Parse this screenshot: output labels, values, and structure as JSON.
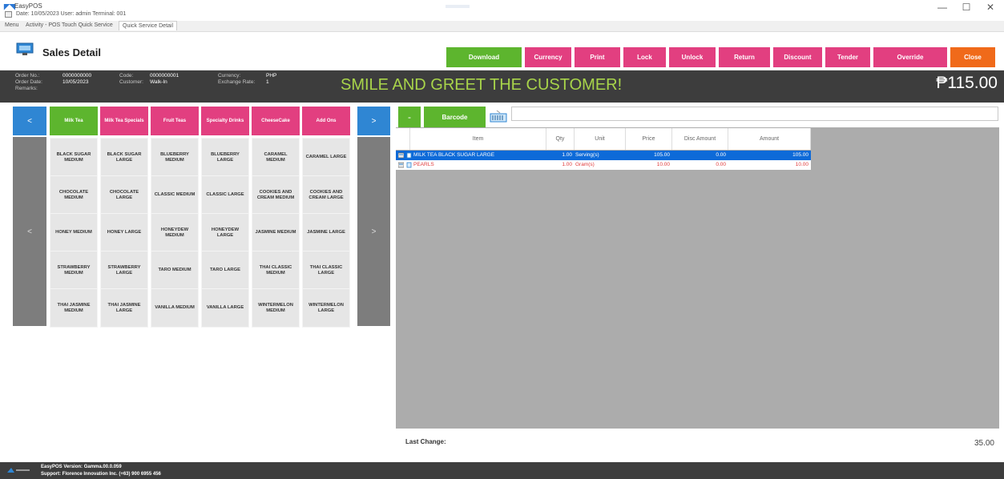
{
  "window": {
    "app_name": "EasyPOS",
    "info_line": "Date: 10/05/2023   User: admin   Terminal: 001",
    "minimize": "—",
    "maximize": "☐",
    "close": "✕"
  },
  "tabs": [
    {
      "label": "Menu"
    },
    {
      "label": "Activity - POS Touch Quick Service"
    },
    {
      "label": "Quick Service Detail"
    }
  ],
  "header": {
    "title": "Sales Detail",
    "buttons": [
      {
        "label": "Download",
        "color": "#5db52e"
      },
      {
        "label": "Currency",
        "color": "#e23f80"
      },
      {
        "label": "Print",
        "color": "#e23f80"
      },
      {
        "label": "Lock",
        "color": "#e23f80"
      },
      {
        "label": "Unlock",
        "color": "#e23f80"
      },
      {
        "label": "Return",
        "color": "#e23f80"
      },
      {
        "label": "Discount",
        "color": "#e23f80"
      },
      {
        "label": "Tender",
        "color": "#e23f80"
      },
      {
        "label": "Override",
        "color": "#e23f80"
      },
      {
        "label": "Close",
        "color": "#f06a1a"
      }
    ]
  },
  "info": {
    "order_no_label": "Order No.:",
    "order_no": "0000000000",
    "order_date_label": "Order Date:",
    "order_date": "10/05/2023",
    "remarks_label": "Remarks:",
    "code_label": "Code:",
    "code": "0000000001",
    "customer_label": "Customer:",
    "customer": "Walk-In",
    "currency_label": "Currency:",
    "currency": "PHP",
    "exchange_rate_label": "Exchange Rate:",
    "exchange_rate": "1",
    "greeting": "SMILE AND GREET THE CUSTOMER!",
    "total": "₱115.00"
  },
  "categories": {
    "prev": "<",
    "next": ">",
    "items": [
      {
        "label": "Milk Tea"
      },
      {
        "label": "Milk Tea Specials"
      },
      {
        "label": "Fruit Teas"
      },
      {
        "label": "Specialty Drinks"
      },
      {
        "label": "CheeseCake"
      },
      {
        "label": "Add Ons"
      }
    ]
  },
  "products": {
    "prev": "<",
    "next": ">",
    "items": [
      "BLACK SUGAR MEDIUM",
      "BLACK SUGAR LARGE",
      "BLUEBERRY MEDIUM",
      "BLUEBERRY LARGE",
      "CARAMEL MEDIUM",
      "CARAMEL LARGE",
      "CHOCOLATE MEDIUM",
      "CHOCOLATE LARGE",
      "CLASSIC MEDIUM",
      "CLASSIC LARGE",
      "COOKIES AND CREAM MEDIUM",
      "COOKIES AND CREAM LARGE",
      "HONEY MEDIUM",
      "HONEY LARGE",
      "HONEYDEW MEDIUM",
      "HONEYDEW LARGE",
      "JASMINE MEDIUM",
      "JASMINE LARGE",
      "STRAWBERRY MEDIUM",
      "STRAWBERRY LARGE",
      "TARO MEDIUM",
      "TARO LARGE",
      "THAI CLASSIC MEDIUM",
      "THAI CLASSIC LARGE",
      "THAI JASMINE MEDIUM",
      "THAI JASMINE LARGE",
      "VANILLA MEDIUM",
      "VANILLA LARGE",
      "WINTERMELON MEDIUM",
      "WINTERMELON LARGE"
    ]
  },
  "barcode": {
    "minus": "-",
    "button": "Barcode",
    "value": ""
  },
  "grid": {
    "columns": {
      "item": "Item",
      "qty": "Qty",
      "unit": "Unit",
      "price": "Price",
      "disc_amount": "Disc Amount",
      "amount": "Amount"
    },
    "rows": [
      {
        "item": "MILK TEA BLACK SUGAR LARGE",
        "qty": "1.00",
        "unit": "Serving(s)",
        "price": "105.00",
        "disc_amount": "0.00",
        "amount": "105.00"
      },
      {
        "item": "PEARLS",
        "qty": "1.00",
        "unit": "Gram(s)",
        "price": "10.00",
        "disc_amount": "0.00",
        "amount": "10.00"
      }
    ]
  },
  "last_change": {
    "label": "Last Change:",
    "value": "35.00"
  },
  "status": {
    "line1": "EasyPOS Version: Gamma.00.0.059",
    "line2": "Support: Florence Innovation Inc. (+63) 900 6955 456"
  }
}
